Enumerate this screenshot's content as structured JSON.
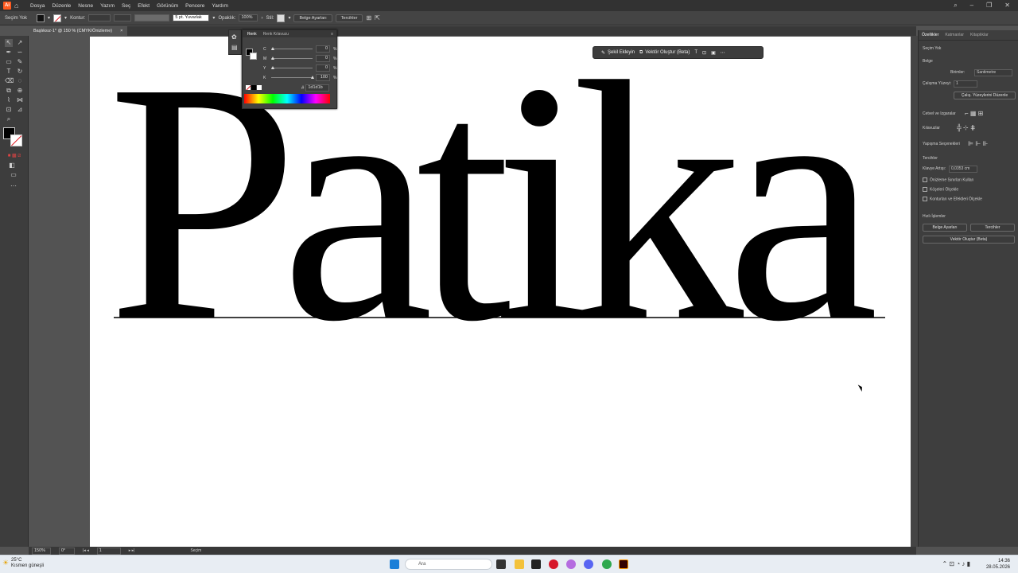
{
  "app": {
    "icon_label": "Ai",
    "menu": [
      "Dosya",
      "Düzenle",
      "Nesne",
      "Yazım",
      "Seç",
      "Efekt",
      "Görünüm",
      "Pencere",
      "Yardım"
    ]
  },
  "control_bar": {
    "selection": "Seçim Yok",
    "stroke_label": "Kontur:",
    "stroke_profile": "5 pt. Yuvarlak",
    "opacity_label": "Opaklık:",
    "opacity_value": "100%",
    "style_label": "Stil:",
    "doc_setup": "Belge Ayarları",
    "preferences": "Tercihler"
  },
  "document_tab": {
    "title": "Başlıksız-1* @ 150 % (CMYK/Önizleme)",
    "close": "×"
  },
  "artwork": {
    "text": "Patika"
  },
  "color_panel": {
    "tabs": [
      "Renk",
      "Renk Kılavuzu"
    ],
    "channels": [
      {
        "label": "C",
        "value": "0",
        "unit": "%",
        "level": 0
      },
      {
        "label": "M",
        "value": "0",
        "unit": "%",
        "level": 0
      },
      {
        "label": "Y",
        "value": "0",
        "unit": "%",
        "level": 0
      },
      {
        "label": "K",
        "value": "100",
        "unit": "%",
        "level": 100
      }
    ],
    "hex_prefix": "#",
    "hex_value": "1d1d1b"
  },
  "context_bar": {
    "add_shape": "Şekil Ekleyin",
    "create_vector": "Vektör Oluştur (Beta)"
  },
  "properties_panel": {
    "tabs": [
      "Özellikler",
      "Katmanlar",
      "Kitaplıklar"
    ],
    "no_selection": "Seçim Yok",
    "document_heading": "Belge",
    "units_label": "Birimler:",
    "units_value": "Santimetre",
    "artboard_label": "Çalışma Yüzeyi:",
    "artboard_value": "1",
    "edit_artboards": "Çalış. Yüzeylerini Düzenle",
    "rulers_grids": "Cetvel ve Izgaralar",
    "guides": "Kılavuzlar",
    "snap_options": "Yapışma Seçenekleri",
    "preferences_heading": "Tercihler",
    "keyboard_increment_label": "Klavye Artışı:",
    "keyboard_increment_value": "0,0353 cm",
    "checks": [
      "Önizleme Sınırları Kullan",
      "Köşeleri Ölçekle",
      "Konturları ve Efektleri Ölçekle"
    ],
    "quick_actions": "Hızlı İşlemler",
    "doc_setup_btn": "Belge Ayarları",
    "prefs_btn": "Tercihler",
    "create_vector_btn": "Vektör Oluştur (Beta)"
  },
  "status_bar": {
    "zoom": "150%",
    "rotation": "0°",
    "artboard_num": "1",
    "tool": "Seçim"
  },
  "taskbar": {
    "temperature": "25°C",
    "weather_text": "Kısmen güneşli",
    "search_placeholder": "Ara",
    "time": "14:36",
    "date": "28.05.2026"
  },
  "colors": {
    "accent": "#ff5a1f",
    "ui_dark": "#323232",
    "panel": "#3e3e3e",
    "artboard": "#ffffff"
  }
}
